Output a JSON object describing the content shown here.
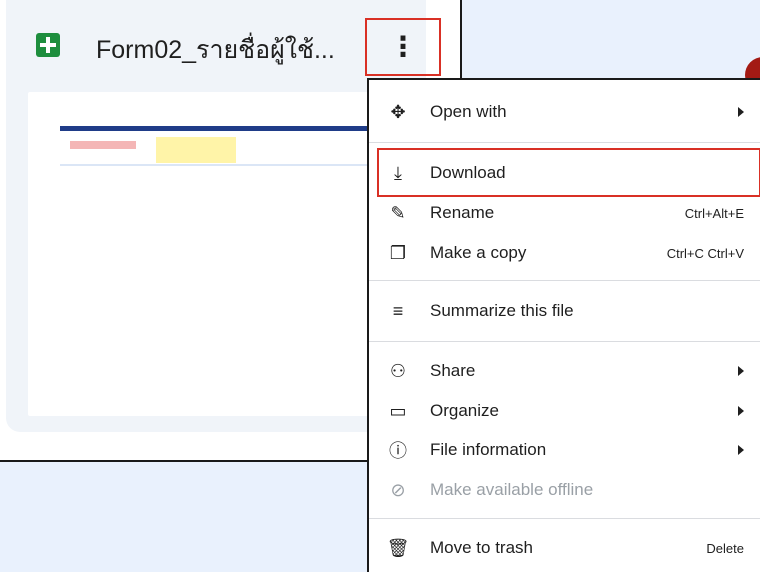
{
  "file": {
    "title": "Form02_รายชื่อผู้ใช้..."
  },
  "menu": {
    "items": [
      {
        "label": "Open with",
        "icon": "move-arrows-icon",
        "shortcut": "",
        "submenu": true
      },
      {
        "label": "Download",
        "icon": "download-icon",
        "shortcut": "",
        "submenu": false,
        "highlighted": true
      },
      {
        "label": "Rename",
        "icon": "pencil-icon",
        "shortcut": "Ctrl+Alt+E",
        "submenu": false
      },
      {
        "label": "Make a copy",
        "icon": "copy-icon",
        "shortcut": "Ctrl+C Ctrl+V",
        "submenu": false
      },
      {
        "label": "Summarize this file",
        "icon": "summarize-icon",
        "shortcut": "",
        "submenu": false
      },
      {
        "label": "Share",
        "icon": "person-add-icon",
        "shortcut": "",
        "submenu": true
      },
      {
        "label": "Organize",
        "icon": "folder-icon",
        "shortcut": "",
        "submenu": true
      },
      {
        "label": "File information",
        "icon": "info-icon",
        "shortcut": "",
        "submenu": true
      },
      {
        "label": "Make available offline",
        "icon": "offline-icon",
        "shortcut": "",
        "submenu": false,
        "disabled": true
      },
      {
        "label": "Move to trash",
        "icon": "trash-icon",
        "shortcut": "Delete",
        "submenu": false
      }
    ]
  },
  "colors": {
    "highlight": "#d93025",
    "sheets_green": "#1e8e3e",
    "background": "#e9f1fd"
  }
}
